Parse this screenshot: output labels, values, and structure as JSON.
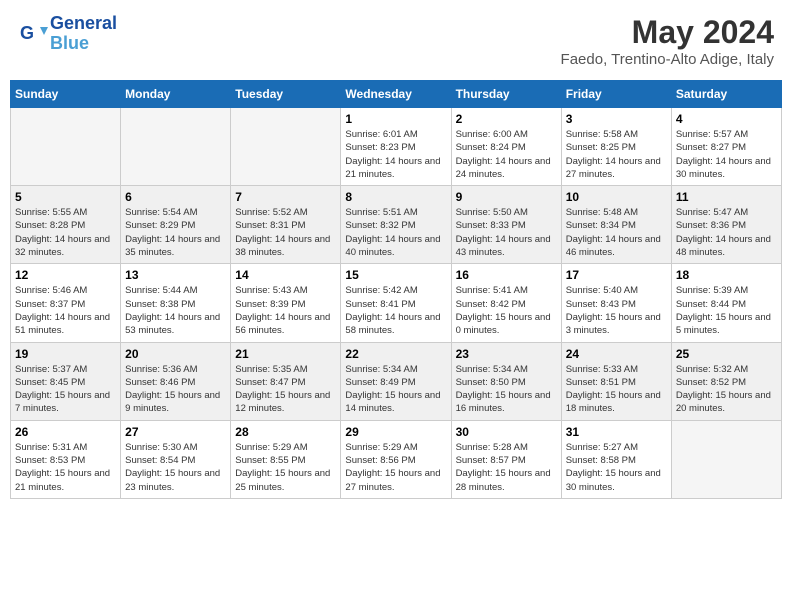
{
  "header": {
    "logo_line1": "General",
    "logo_line2": "Blue",
    "month": "May 2024",
    "location": "Faedo, Trentino-Alto Adige, Italy"
  },
  "weekdays": [
    "Sunday",
    "Monday",
    "Tuesday",
    "Wednesday",
    "Thursday",
    "Friday",
    "Saturday"
  ],
  "weeks": [
    [
      {
        "day": null,
        "empty": true
      },
      {
        "day": null,
        "empty": true
      },
      {
        "day": null,
        "empty": true
      },
      {
        "day": "1",
        "sunrise": "6:01 AM",
        "sunset": "8:23 PM",
        "daylight": "14 hours and 21 minutes."
      },
      {
        "day": "2",
        "sunrise": "6:00 AM",
        "sunset": "8:24 PM",
        "daylight": "14 hours and 24 minutes."
      },
      {
        "day": "3",
        "sunrise": "5:58 AM",
        "sunset": "8:25 PM",
        "daylight": "14 hours and 27 minutes."
      },
      {
        "day": "4",
        "sunrise": "5:57 AM",
        "sunset": "8:27 PM",
        "daylight": "14 hours and 30 minutes."
      }
    ],
    [
      {
        "day": "5",
        "sunrise": "5:55 AM",
        "sunset": "8:28 PM",
        "daylight": "14 hours and 32 minutes."
      },
      {
        "day": "6",
        "sunrise": "5:54 AM",
        "sunset": "8:29 PM",
        "daylight": "14 hours and 35 minutes."
      },
      {
        "day": "7",
        "sunrise": "5:52 AM",
        "sunset": "8:31 PM",
        "daylight": "14 hours and 38 minutes."
      },
      {
        "day": "8",
        "sunrise": "5:51 AM",
        "sunset": "8:32 PM",
        "daylight": "14 hours and 40 minutes."
      },
      {
        "day": "9",
        "sunrise": "5:50 AM",
        "sunset": "8:33 PM",
        "daylight": "14 hours and 43 minutes."
      },
      {
        "day": "10",
        "sunrise": "5:48 AM",
        "sunset": "8:34 PM",
        "daylight": "14 hours and 46 minutes."
      },
      {
        "day": "11",
        "sunrise": "5:47 AM",
        "sunset": "8:36 PM",
        "daylight": "14 hours and 48 minutes."
      }
    ],
    [
      {
        "day": "12",
        "sunrise": "5:46 AM",
        "sunset": "8:37 PM",
        "daylight": "14 hours and 51 minutes."
      },
      {
        "day": "13",
        "sunrise": "5:44 AM",
        "sunset": "8:38 PM",
        "daylight": "14 hours and 53 minutes."
      },
      {
        "day": "14",
        "sunrise": "5:43 AM",
        "sunset": "8:39 PM",
        "daylight": "14 hours and 56 minutes."
      },
      {
        "day": "15",
        "sunrise": "5:42 AM",
        "sunset": "8:41 PM",
        "daylight": "14 hours and 58 minutes."
      },
      {
        "day": "16",
        "sunrise": "5:41 AM",
        "sunset": "8:42 PM",
        "daylight": "15 hours and 0 minutes."
      },
      {
        "day": "17",
        "sunrise": "5:40 AM",
        "sunset": "8:43 PM",
        "daylight": "15 hours and 3 minutes."
      },
      {
        "day": "18",
        "sunrise": "5:39 AM",
        "sunset": "8:44 PM",
        "daylight": "15 hours and 5 minutes."
      }
    ],
    [
      {
        "day": "19",
        "sunrise": "5:37 AM",
        "sunset": "8:45 PM",
        "daylight": "15 hours and 7 minutes."
      },
      {
        "day": "20",
        "sunrise": "5:36 AM",
        "sunset": "8:46 PM",
        "daylight": "15 hours and 9 minutes."
      },
      {
        "day": "21",
        "sunrise": "5:35 AM",
        "sunset": "8:47 PM",
        "daylight": "15 hours and 12 minutes."
      },
      {
        "day": "22",
        "sunrise": "5:34 AM",
        "sunset": "8:49 PM",
        "daylight": "15 hours and 14 minutes."
      },
      {
        "day": "23",
        "sunrise": "5:34 AM",
        "sunset": "8:50 PM",
        "daylight": "15 hours and 16 minutes."
      },
      {
        "day": "24",
        "sunrise": "5:33 AM",
        "sunset": "8:51 PM",
        "daylight": "15 hours and 18 minutes."
      },
      {
        "day": "25",
        "sunrise": "5:32 AM",
        "sunset": "8:52 PM",
        "daylight": "15 hours and 20 minutes."
      }
    ],
    [
      {
        "day": "26",
        "sunrise": "5:31 AM",
        "sunset": "8:53 PM",
        "daylight": "15 hours and 21 minutes."
      },
      {
        "day": "27",
        "sunrise": "5:30 AM",
        "sunset": "8:54 PM",
        "daylight": "15 hours and 23 minutes."
      },
      {
        "day": "28",
        "sunrise": "5:29 AM",
        "sunset": "8:55 PM",
        "daylight": "15 hours and 25 minutes."
      },
      {
        "day": "29",
        "sunrise": "5:29 AM",
        "sunset": "8:56 PM",
        "daylight": "15 hours and 27 minutes."
      },
      {
        "day": "30",
        "sunrise": "5:28 AM",
        "sunset": "8:57 PM",
        "daylight": "15 hours and 28 minutes."
      },
      {
        "day": "31",
        "sunrise": "5:27 AM",
        "sunset": "8:58 PM",
        "daylight": "15 hours and 30 minutes."
      },
      {
        "day": null,
        "empty": true
      }
    ]
  ]
}
